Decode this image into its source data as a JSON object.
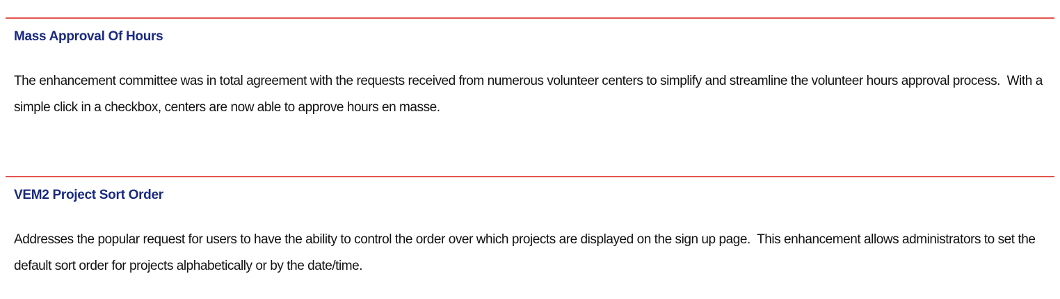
{
  "sections": [
    {
      "title": "Mass Approval Of Hours",
      "body": "The enhancement committee was in total agreement with the requests received from numerous volunteer centers to simplify and streamline the volunteer hours approval process.  With a simple click in a checkbox, centers are now able to approve hours en masse."
    },
    {
      "title": "VEM2 Project Sort Order",
      "body": "Addresses the popular request for users to have the ability to control the order over which projects are displayed on the sign up page.  This enhancement allows administrators to set the default sort order for projects alphabetically or by the date/time."
    }
  ],
  "colors": {
    "rule": "#e0554f",
    "heading": "#1a2a80",
    "text": "#111111",
    "background": "#ffffff"
  }
}
